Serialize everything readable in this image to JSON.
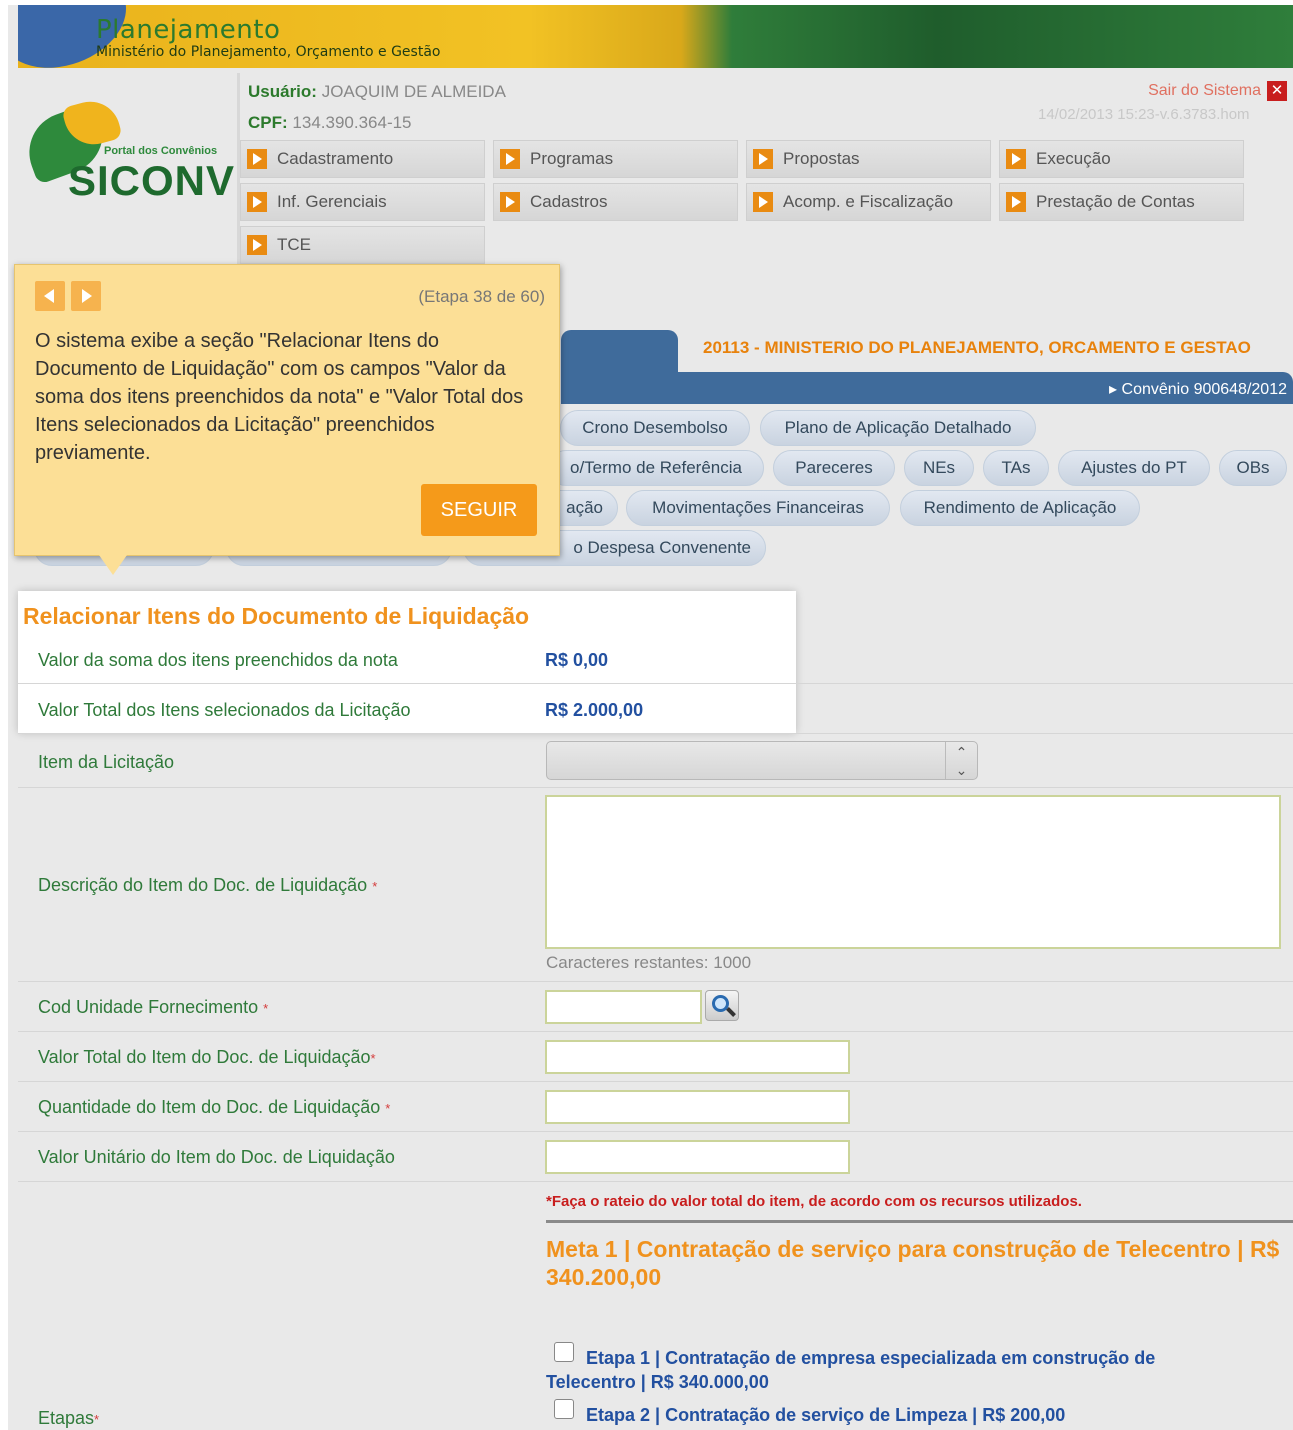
{
  "banner": {
    "title": "Planejamento",
    "subtitle": "Ministério do Planejamento, Orçamento e Gestão"
  },
  "logo": {
    "portal": "Portal dos Convênios",
    "name": "SICONV"
  },
  "header": {
    "user_label": "Usuário:",
    "user_name": "JOAQUIM DE ALMEIDA",
    "cpf_label": "CPF:",
    "cpf_value": "134.390.364-15",
    "logout": "Sair do Sistema",
    "version": "14/02/2013 15:23-v.6.3783.hom"
  },
  "menu": [
    {
      "label": "Cadastramento"
    },
    {
      "label": "Programas"
    },
    {
      "label": "Propostas"
    },
    {
      "label": "Execução"
    },
    {
      "label": "Inf. Gerenciais"
    },
    {
      "label": "Cadastros"
    },
    {
      "label": "Acomp. e Fiscalização"
    },
    {
      "label": "Prestação de Contas"
    },
    {
      "label": "TCE"
    }
  ],
  "context": {
    "organization": "20113 - MINISTERIO DO PLANEJAMENTO, ORCAMENTO E GESTAO",
    "convenio": "Convênio 900648/2012"
  },
  "tabs": {
    "row1": [
      "Crono Desembolso",
      "Plano de Aplicação Detalhado"
    ],
    "row2": [
      "o/Termo de Referência",
      "Pareceres",
      "NEs",
      "TAs",
      "Ajustes do PT",
      "OBs"
    ],
    "row3": [
      "ação",
      "Movimentações Financeiras",
      "Rendimento de Aplicação"
    ],
    "row4": [
      "o Despesa Convenente"
    ]
  },
  "tooltip": {
    "step": "(Etapa 38 de 60)",
    "text": "O sistema exibe a seção \"Relacionar Itens do Documento de Liquidação\" com os campos \"Valor da soma dos itens preenchidos da nota\" e \"Valor Total dos Itens selecionados da Licitação\" preenchidos previamente.",
    "button": "SEGUIR"
  },
  "section": {
    "title": "Relacionar Itens do Documento de Liquidação",
    "soma_label": "Valor da soma dos itens preenchidos da nota",
    "soma_value": "R$ 0,00",
    "total_label": "Valor Total dos Itens selecionados da Licitação",
    "total_value": "R$ 2.000,00"
  },
  "form": {
    "item_label": "Item da Licitação",
    "descricao_label": "Descrição do Item do Doc. de Liquidação",
    "counter": "Caracteres restantes: 1000",
    "cod_label": "Cod Unidade Fornecimento",
    "valor_total_label": "Valor Total do Item do Doc. de Liquidação",
    "quantidade_label": "Quantidade do Item do Doc. de Liquidação",
    "valor_unitario_label": "Valor Unitário do Item do Doc. de Liquidação",
    "required_mark": "*",
    "warning": "*Faça o rateio do valor total do item, de acordo com os recursos utilizados.",
    "etapas_label": "Etapas"
  },
  "meta": {
    "title": "Meta 1 | Contratação de serviço para construção de Telecentro | R$ 340.200,00",
    "etapas": [
      {
        "label": "Etapa 1 | Contratação de empresa especializada em construção de Telecentro | R$ 340.000,00",
        "checked": false
      },
      {
        "label": "Etapa 2 | Contratação de serviço de Limpeza | R$ 200,00",
        "checked": false
      }
    ]
  },
  "colors": {
    "accent_orange": "#f0921e",
    "label_green": "#2f7a3a",
    "value_blue": "#2250a0",
    "tab_blue": "#3f6b9b",
    "tooltip_bg": "#fcdf96"
  }
}
